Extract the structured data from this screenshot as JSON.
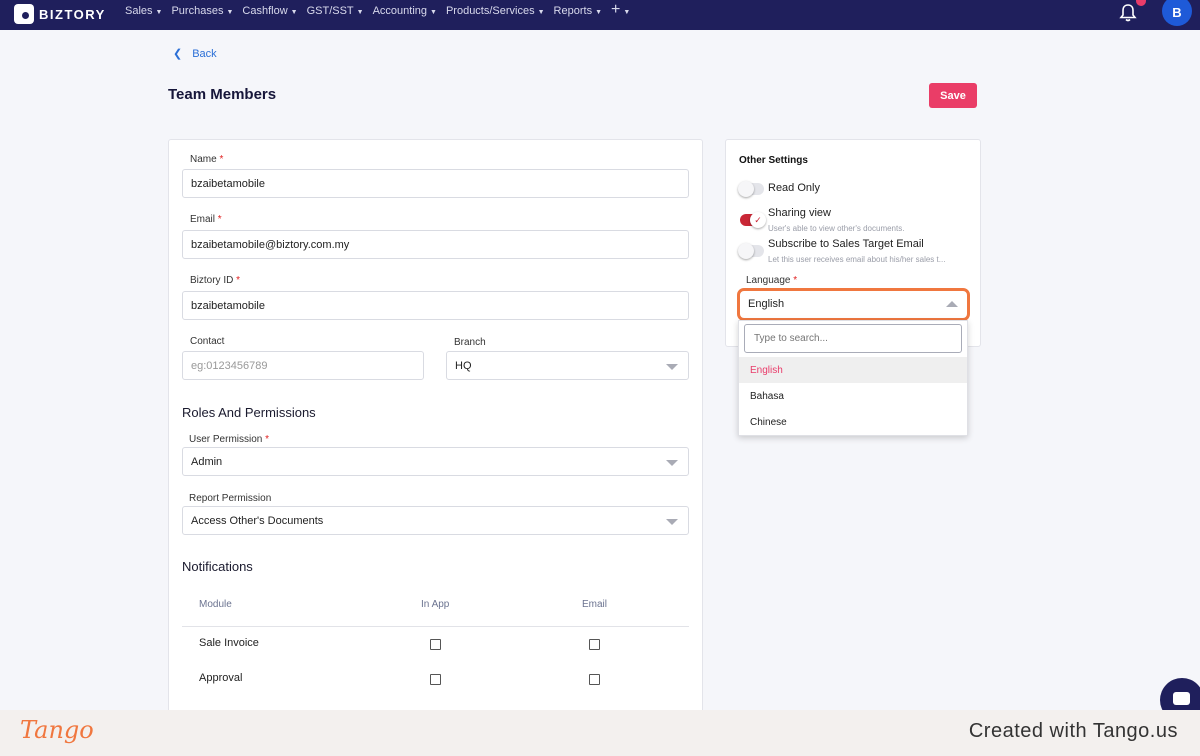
{
  "nav": {
    "logo_text": "BIZTORY",
    "items": [
      "Sales",
      "Purchases",
      "Cashflow",
      "GST/SST",
      "Accounting",
      "Products/Services",
      "Reports"
    ],
    "plus": "+",
    "avatar_initial": "B"
  },
  "header": {
    "back_label": "Back",
    "title": "Team Members",
    "save_label": "Save"
  },
  "form": {
    "name_label": "Name",
    "name_value": "bzaibetamobile",
    "email_label": "Email",
    "email_value": "bzaibetamobile@biztory.com.my",
    "biztory_id_label": "Biztory ID",
    "biztory_id_value": "bzaibetamobile",
    "contact_label": "Contact",
    "contact_placeholder": "eg:0123456789",
    "branch_label": "Branch",
    "branch_value": "HQ",
    "required_mark": "*"
  },
  "roles": {
    "title": "Roles And Permissions",
    "user_permission_label": "User Permission",
    "user_permission_value": "Admin",
    "report_permission_label": "Report Permission",
    "report_permission_value": "Access Other's Documents"
  },
  "notifications": {
    "title": "Notifications",
    "col_module": "Module",
    "col_in_app": "In App",
    "col_email": "Email",
    "rows": [
      "Sale Invoice",
      "Approval"
    ]
  },
  "other_settings": {
    "title": "Other Settings",
    "read_only_label": "Read Only",
    "read_only_on": false,
    "sharing_view_label": "Sharing view",
    "sharing_view_hint": "User's able to view other's documents.",
    "sharing_view_on": true,
    "subscribe_label": "Subscribe to Sales Target Email",
    "subscribe_hint": "Let this user receives email about his/her sales t...",
    "subscribe_on": false,
    "language_label": "Language",
    "language_value": "English"
  },
  "language_dropdown": {
    "search_placeholder": "Type to search...",
    "options": [
      "English",
      "Bahasa",
      "Chinese"
    ],
    "selected": "English"
  },
  "footer": {
    "tango_logo": "Tango",
    "created_with": "Created with Tango.us"
  },
  "colors": {
    "nav_bg": "#1f1f5c",
    "accent": "#ea3d67",
    "highlight_outline": "#f0773f",
    "toggle_on": "#c92736"
  }
}
